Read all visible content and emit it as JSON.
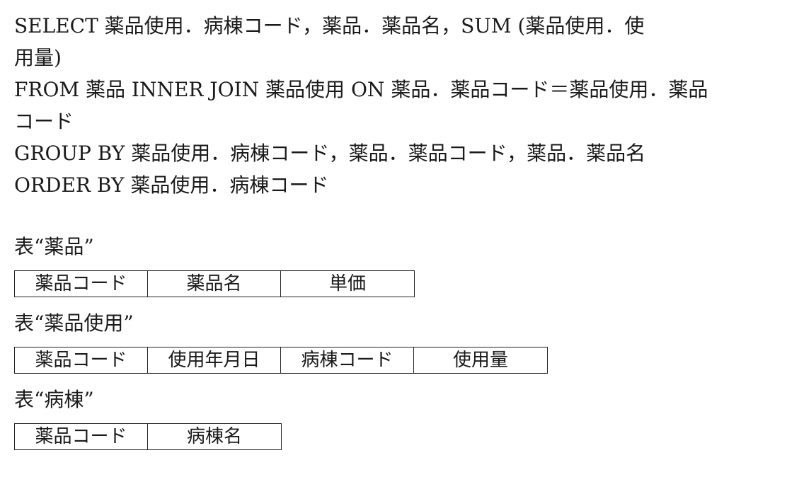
{
  "sql": {
    "lines": [
      "SELECT 薬品使用．病棟コード，薬品．薬品名，SUM (薬品使用．使",
      "用量)",
      "FROM 薬品 INNER JOIN 薬品使用 ON 薬品．薬品コード＝薬品使用．薬品",
      "コード",
      "GROUP BY 薬品使用．病棟コード，薬品．薬品コード，薬品．薬品名",
      "ORDER BY 薬品使用．病棟コード"
    ]
  },
  "tables": [
    {
      "caption": "表“薬品”",
      "columns": [
        "薬品コード",
        "薬品名",
        "単価"
      ]
    },
    {
      "caption": "表“薬品使用”",
      "columns": [
        "薬品コード",
        "使用年月日",
        "病棟コード",
        "使用量"
      ]
    },
    {
      "caption": "表“病棟”",
      "columns": [
        "薬品コード",
        "病棟名"
      ]
    }
  ]
}
